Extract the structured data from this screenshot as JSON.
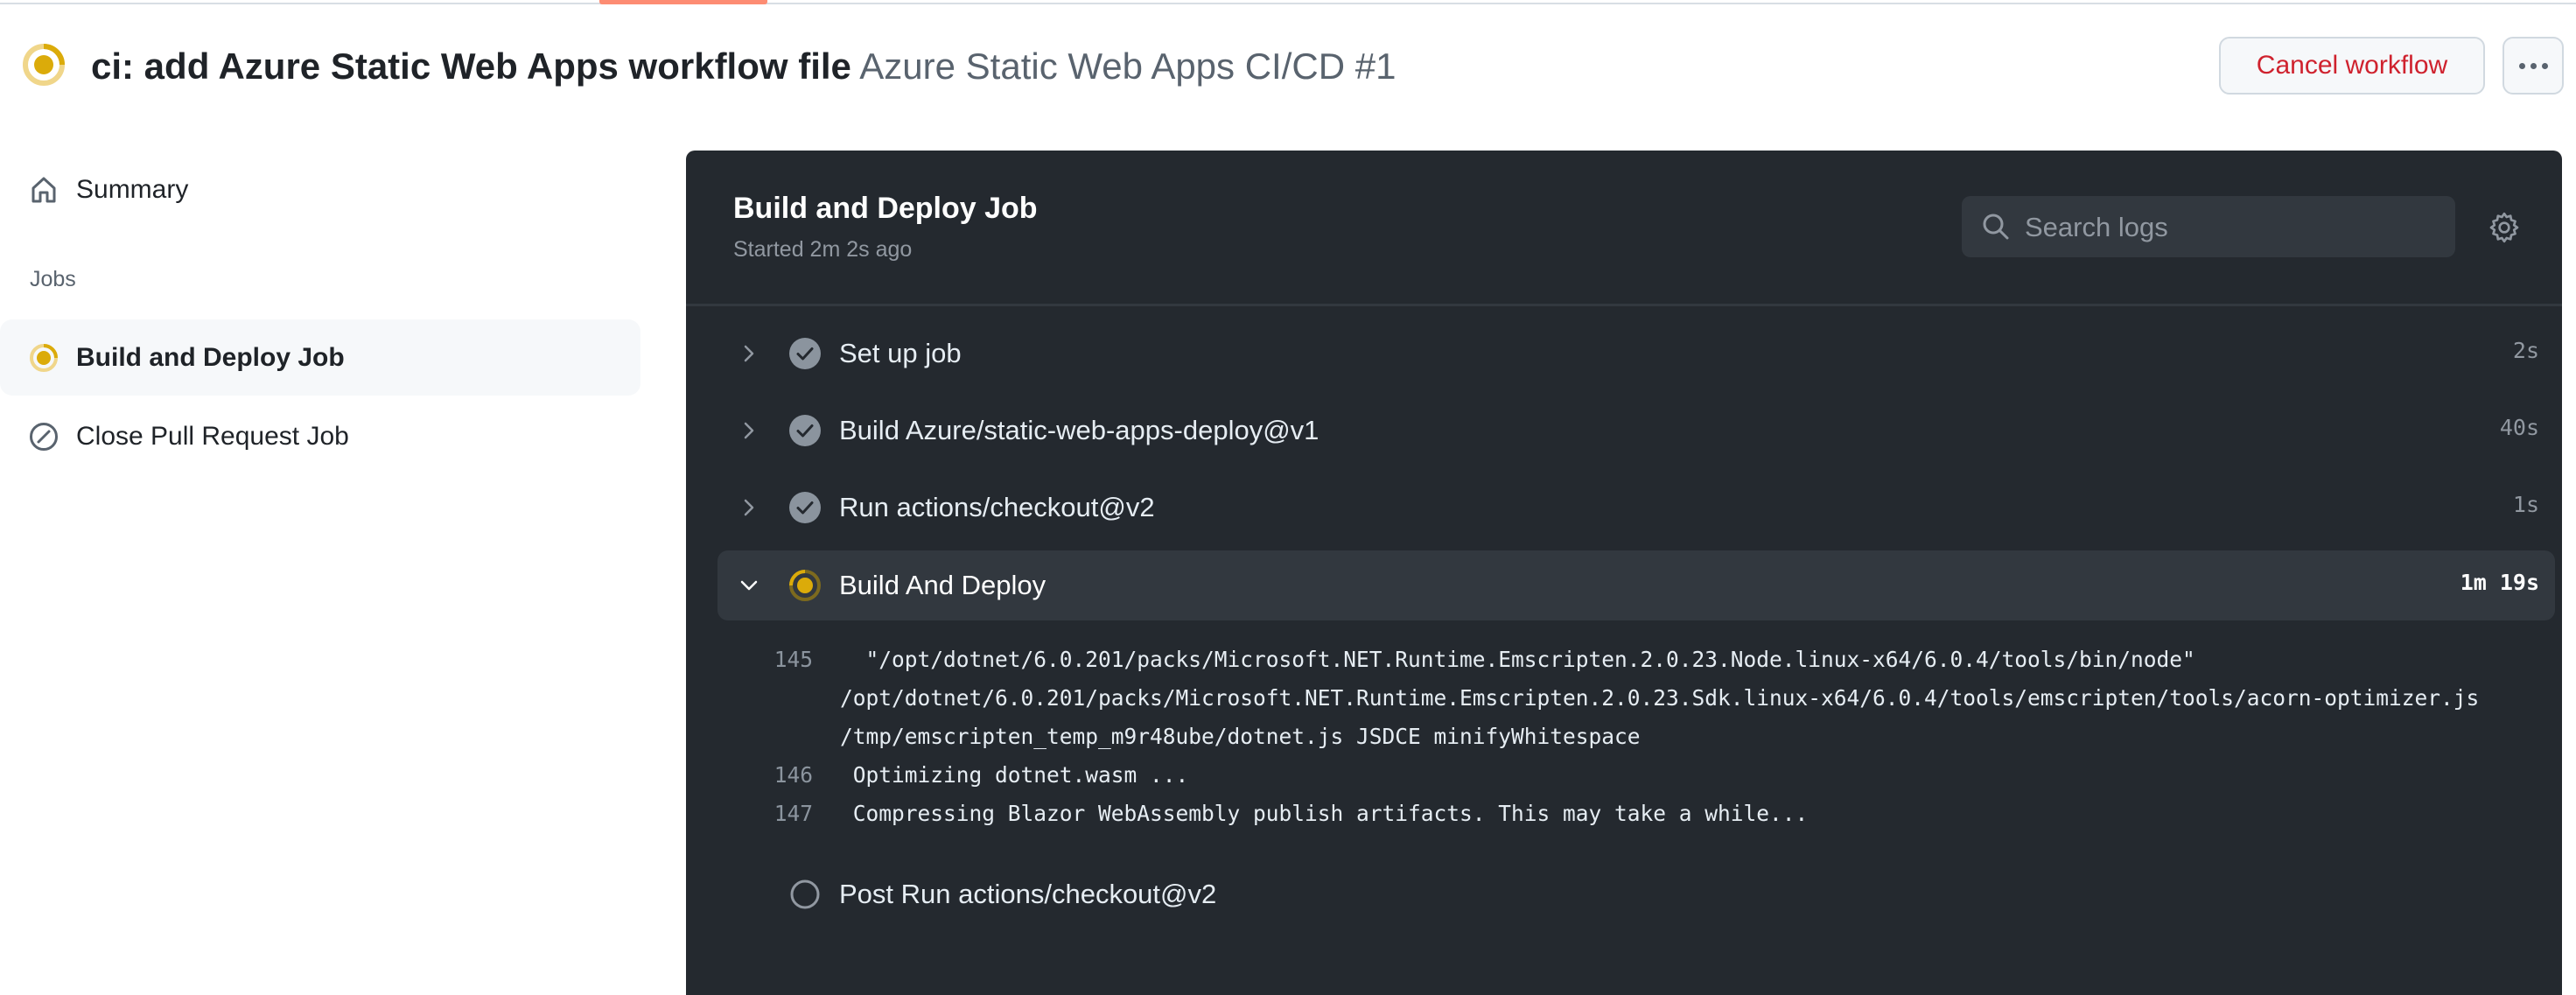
{
  "header": {
    "status": "in-progress",
    "commit_title": "ci: add Azure Static Web Apps workflow file",
    "workflow_name": "Azure Static Web Apps CI/CD #1",
    "cancel_label": "Cancel workflow",
    "more_label": "More actions"
  },
  "colors": {
    "in_progress": "#dbab0a",
    "danger": "#cf222e",
    "tab_indicator": "#fd8c73",
    "panel_bg": "#24292f"
  },
  "sidebar": {
    "summary_label": "Summary",
    "jobs_heading": "Jobs",
    "jobs": [
      {
        "label": "Build and Deploy Job",
        "status": "in-progress",
        "selected": true
      },
      {
        "label": "Close Pull Request Job",
        "status": "skipped",
        "selected": false
      }
    ]
  },
  "job": {
    "title": "Build and Deploy Job",
    "started": "Started 2m 2s ago",
    "search_placeholder": "Search logs",
    "steps": [
      {
        "name": "Set up job",
        "duration": "2s",
        "status": "success"
      },
      {
        "name": "Build Azure/static-web-apps-deploy@v1",
        "duration": "40s",
        "status": "success"
      },
      {
        "name": "Run actions/checkout@v2",
        "duration": "1s",
        "status": "success"
      },
      {
        "name": "Build And Deploy",
        "duration": "1m 19s",
        "status": "in-progress",
        "expanded": true
      },
      {
        "name": "Post Run actions/checkout@v2",
        "duration": "",
        "status": "pending"
      }
    ],
    "log_lines": [
      {
        "num": "145",
        "text": "  \"/opt/dotnet/6.0.201/packs/Microsoft.NET.Runtime.Emscripten.2.0.23.Node.linux-x64/6.0.4/tools/bin/node\""
      },
      {
        "num": "",
        "text": "/opt/dotnet/6.0.201/packs/Microsoft.NET.Runtime.Emscripten.2.0.23.Sdk.linux-x64/6.0.4/tools/emscripten/tools/acorn-optimizer.js"
      },
      {
        "num": "",
        "text": "/tmp/emscripten_temp_m9r48ube/dotnet.js JSDCE minifyWhitespace"
      },
      {
        "num": "146",
        "text": " Optimizing dotnet.wasm ..."
      },
      {
        "num": "147",
        "text": " Compressing Blazor WebAssembly publish artifacts. This may take a while..."
      }
    ]
  }
}
